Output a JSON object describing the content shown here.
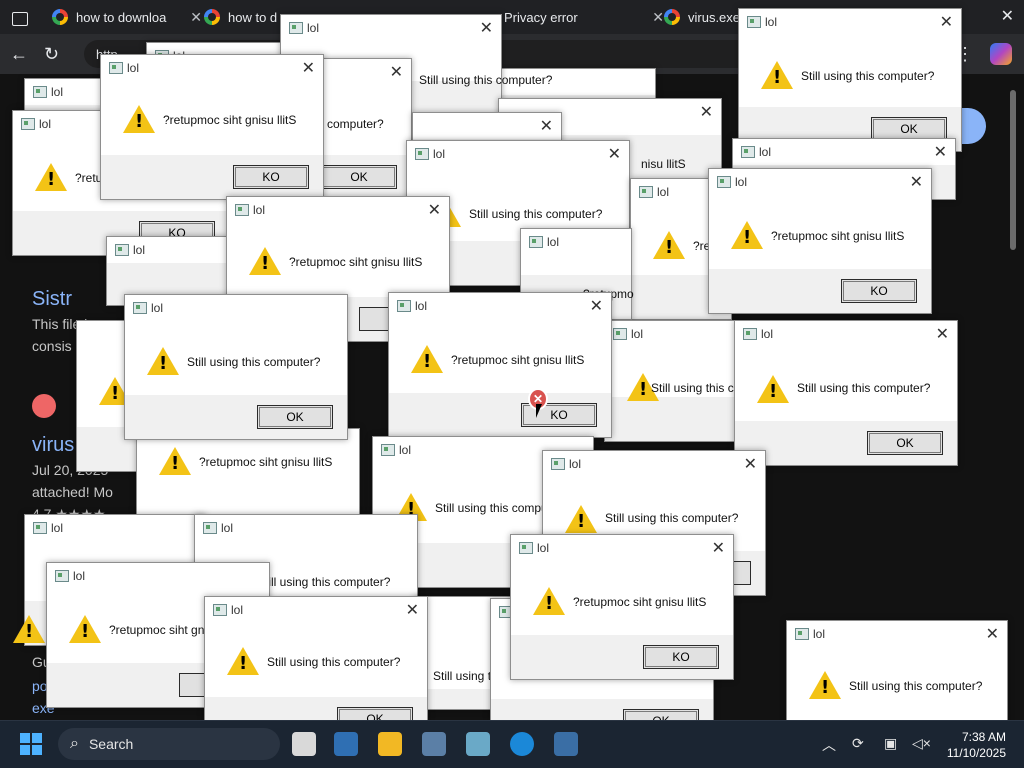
{
  "browser": {
    "tabs": [
      {
        "label": "how to downloa",
        "close": "✕"
      },
      {
        "label": "how to d",
        "close": ""
      },
      {
        "label": "",
        "close": ""
      },
      {
        "label": "Privacy error",
        "close": "✕"
      },
      {
        "label": "virus.exe",
        "close": ""
      }
    ],
    "window_close": "✕",
    "address_text": "http"
  },
  "background_page": {
    "link1": "Sistr",
    "text1": "This file ha",
    "text2": "consis",
    "link2": "virus",
    "date": "Jul 20, 2025",
    "text3": "attached! Mo",
    "text4": "4.7 ★★★★",
    "link3": "po",
    "link4": "exe",
    "text5": "Gu"
  },
  "dialog_title": "lol",
  "dialog_close": "✕",
  "messages": {
    "normal": "Still using this computer?",
    "reversed": "?retupmoc siht gnisu llitS"
  },
  "buttons": {
    "ok": "OK",
    "ko": "KO"
  },
  "taskbar": {
    "search_label": "Search",
    "time": "7:38 AM",
    "date": "11/10/2025"
  },
  "colors": {
    "warning_yellow": "#f3c316",
    "taskbar_bg": "#1b2532",
    "browser_bg": "#202124"
  }
}
